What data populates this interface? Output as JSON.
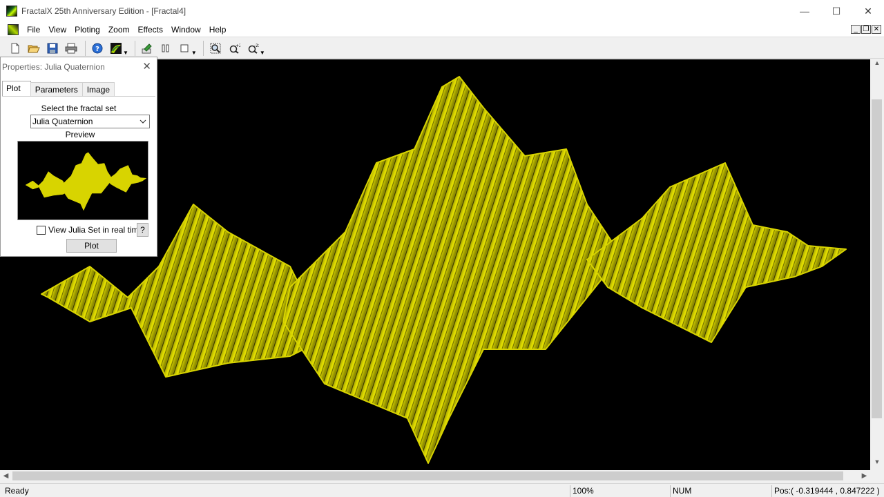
{
  "window": {
    "title": "FractalX 25th Anniversary Edition - [Fractal4]",
    "minimize": "—",
    "maximize": "☐",
    "close": "✕"
  },
  "menu": {
    "items": [
      "File",
      "View",
      "Ploting",
      "Zoom",
      "Effects",
      "Window",
      "Help"
    ],
    "mdi_min": "_",
    "mdi_restore": "❐",
    "mdi_close": "✕"
  },
  "toolbar": {
    "icons": [
      "new-icon",
      "open-icon",
      "save-icon",
      "print-icon",
      "help-icon",
      "fractal-icon",
      "plot-icon",
      "pause-icon",
      "stop-icon",
      "zoom-window-icon",
      "zoom-in-icon",
      "zoom-out-icon"
    ]
  },
  "properties": {
    "title": "Properties: Julia Quaternion",
    "close": "✕",
    "tabs": [
      "Plot",
      "Parameters",
      "Image"
    ],
    "select_label": "Select the fractal set",
    "selected_set": "Julia Quaternion",
    "preview_label": "Preview",
    "realtime_label": "View Julia Set in real time",
    "help_label": "?",
    "plot_label": "Plot"
  },
  "status": {
    "ready": "Ready",
    "zoom": "100%",
    "num": "NUM",
    "pos": "Pos:( -0.319444 , 0.847222 )"
  },
  "colors": {
    "fractal": "#d8d400",
    "fractal_dark": "#6b6a00",
    "background": "#000000"
  }
}
